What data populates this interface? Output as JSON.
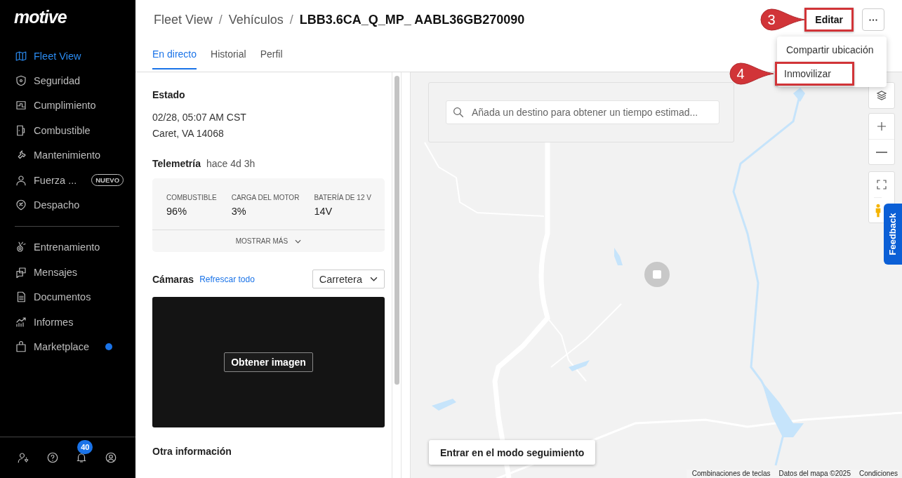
{
  "sidebar": {
    "logo": "motive",
    "primary_items": [
      {
        "label": "Fleet View",
        "selected": true
      },
      {
        "label": "Seguridad",
        "selected": false
      },
      {
        "label": "Cumplimiento",
        "selected": false
      },
      {
        "label": "Combustible",
        "selected": false
      },
      {
        "label": "Mantenimiento",
        "selected": false
      },
      {
        "label": "Fuerza ...",
        "selected": false,
        "badge": "NUEVO"
      },
      {
        "label": "Despacho",
        "selected": false
      }
    ],
    "secondary_items": [
      {
        "label": "Entrenamiento",
        "selected": false
      },
      {
        "label": "Mensajes",
        "selected": false
      },
      {
        "label": "Documentos",
        "selected": false
      },
      {
        "label": "Informes",
        "selected": false
      },
      {
        "label": "Marketplace",
        "selected": false,
        "color": "#1a73e8"
      }
    ],
    "notification_count": "40"
  },
  "breadcrumb": [
    {
      "kind": "link",
      "text": "Fleet View"
    },
    {
      "kind": "separator",
      "text": "/"
    },
    {
      "kind": "link",
      "text": "Vehículos"
    },
    {
      "kind": "separator",
      "text": "/"
    },
    {
      "kind": "current",
      "text": "LBB3.6CA_Q_MP_ AABL36GB270090"
    }
  ],
  "edit_button": {
    "label": "Editar",
    "highlighted": true
  },
  "menu": {
    "items": [
      {
        "label": "Compartir ubicación",
        "highlighted": false
      },
      {
        "label": "Inmovilizar",
        "highlighted": true
      }
    ]
  },
  "callouts": [
    {
      "number": "3"
    },
    {
      "number": "4"
    }
  ],
  "tabs": [
    {
      "label": "En directo",
      "selected": true
    },
    {
      "label": "Historial",
      "selected": false
    },
    {
      "label": "Perfil",
      "selected": false
    }
  ],
  "status": {
    "heading": "Estado",
    "lines": [
      "02/28, 05:07 AM CST",
      "Caret, VA 14068"
    ]
  },
  "telemetry": {
    "heading": "Telemetría",
    "age": "hace 4d 3h",
    "metrics": [
      {
        "label": "COMBUSTIBLE",
        "value": "96%"
      },
      {
        "label": "CARGA DEL MOTOR",
        "value": "3%"
      },
      {
        "label": "BATERÍA DE 12 V",
        "value": "14V"
      }
    ],
    "show_more": "MOSTRAR MÁS"
  },
  "cameras": {
    "heading": "Cámaras",
    "refresh": "Refrescar todo",
    "view_select": "Carretera",
    "capture_button": "Obtener imagen"
  },
  "other_info": {
    "heading": "Otra información"
  },
  "map": {
    "search_placeholder": "Añada un destino para obtener un tiempo estimad...",
    "follow_button": "Entrar en el modo seguimiento",
    "footer_links": [
      "Combinaciones de teclas",
      "Datos del mapa ©2025",
      "Condiciones"
    ],
    "feedback": "Feedback"
  }
}
